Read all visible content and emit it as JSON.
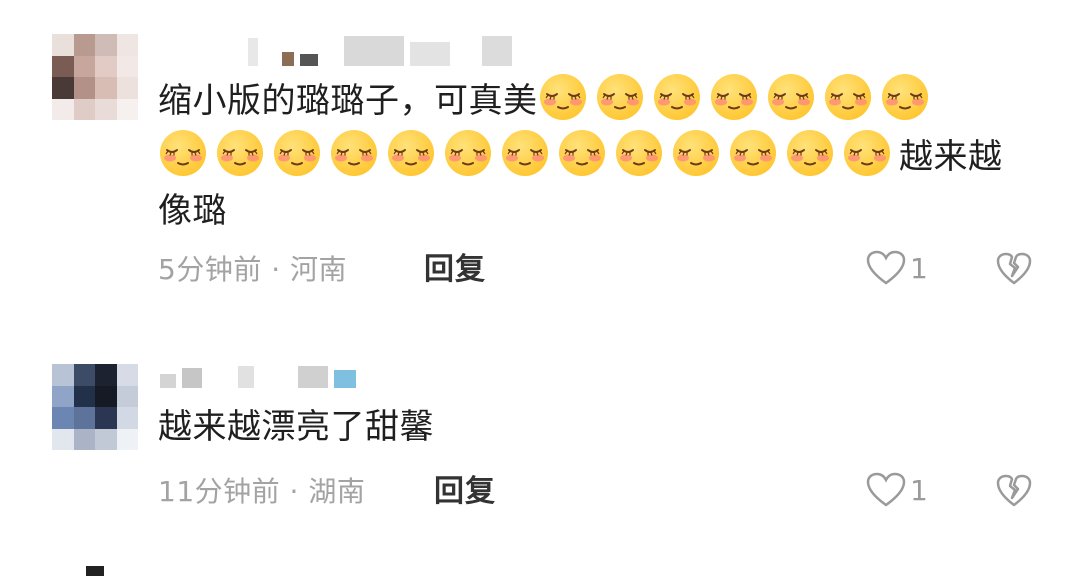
{
  "comments": [
    {
      "text_before": "缩小版的璐璐子，可真美",
      "emoji_name": "shy-blush-emoji",
      "emoji_line1_count": 7,
      "emoji_line2_count": 13,
      "text_after": "越来越",
      "text_line3": "像璐",
      "meta": "5分钟前 · 河南",
      "reply_label": "回复",
      "like_count": "1"
    },
    {
      "text": "越来越漂亮了甜馨",
      "meta": "11分钟前 · 湖南",
      "reply_label": "回复",
      "like_count": "1"
    }
  ],
  "colors": {
    "text": "#1f1f1f",
    "meta": "#a3a3a3",
    "emoji_face": "#ffc52e",
    "emoji_blush": "#ff8a7a"
  }
}
